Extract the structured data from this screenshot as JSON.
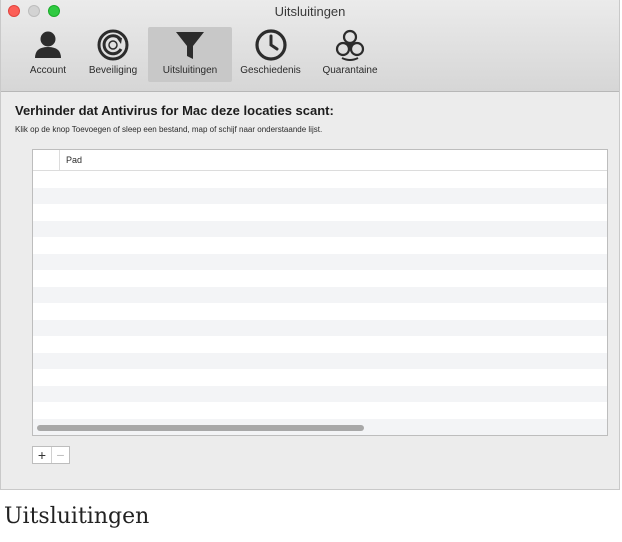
{
  "window": {
    "title": "Uitsluitingen",
    "traffic_lights": {
      "close": "#fc5f57",
      "minimize": "#d3d3d3",
      "zoom": "#2fca41"
    }
  },
  "toolbar": {
    "items": [
      {
        "label": "Account",
        "icon": "person-icon",
        "active": false
      },
      {
        "label": "Beveiliging",
        "icon": "shield-refresh-icon",
        "active": false
      },
      {
        "label": "Uitsluitingen",
        "icon": "funnel-icon",
        "active": true
      },
      {
        "label": "Geschiedenis",
        "icon": "clock-icon",
        "active": false
      },
      {
        "label": "Quarantaine",
        "icon": "biohazard-icon",
        "active": false
      }
    ]
  },
  "main": {
    "heading": "Verhinder dat Antivirus for Mac deze locaties scant:",
    "instruction": "Klik op de knop Toevoegen of sleep een bestand, map of schijf naar onderstaande lijst.",
    "table": {
      "column_header": "Pad",
      "rows": []
    },
    "add_button": "+",
    "remove_button": "−"
  },
  "caption": "Uitsluitingen"
}
